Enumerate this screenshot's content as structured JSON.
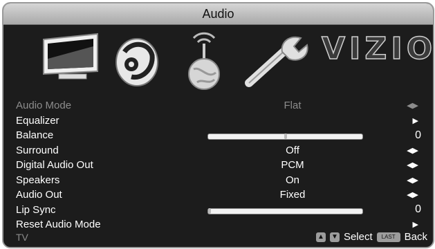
{
  "window": {
    "title": "Audio"
  },
  "brand": "VIZIO",
  "menu_icons": [
    "tv-icon",
    "music-note-icon",
    "globe-antenna-icon",
    "wrench-icon"
  ],
  "menu": {
    "rows": [
      {
        "label": "Audio Mode",
        "value": "Flat",
        "control": "arrows",
        "dim": true
      },
      {
        "label": "Equalizer",
        "value": "",
        "control": "submenu"
      },
      {
        "label": "Balance",
        "value": "0",
        "control": "slider",
        "level": 0.5
      },
      {
        "label": "Surround",
        "value": "Off",
        "control": "arrows"
      },
      {
        "label": "Digital Audio Out",
        "value": "PCM",
        "control": "arrows"
      },
      {
        "label": "Speakers",
        "value": "On",
        "control": "arrows"
      },
      {
        "label": "Audio Out",
        "value": "Fixed",
        "control": "arrows"
      },
      {
        "label": "Lip Sync",
        "value": "0",
        "control": "slider",
        "level": 0.0
      },
      {
        "label": "Reset Audio Mode",
        "value": "",
        "control": "submenu"
      }
    ]
  },
  "footer": {
    "source": "TV",
    "select_label": "Select",
    "back_key_label": "LAST",
    "back_label": "Back"
  }
}
